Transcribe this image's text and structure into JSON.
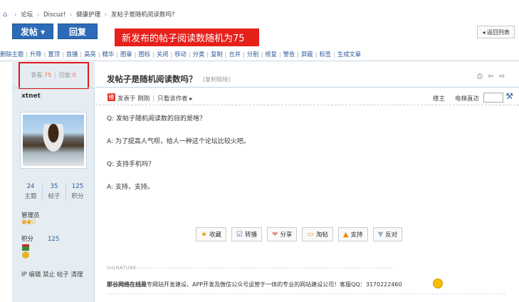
{
  "breadcrumb": {
    "home_icon": "home-icon",
    "items": [
      "论坛",
      "Discuz!",
      "健康护理",
      "发帖子是随机阅读数吗?"
    ]
  },
  "buttons": {
    "post": "发帖 ▾",
    "reply": "回复",
    "back": "◂ 返回列表"
  },
  "banner": "新发布的帖子阅读数随机为75",
  "modbar": [
    "删除主题",
    "升降",
    "置顶",
    "首播",
    "高亮",
    "精华",
    "图章",
    "图标",
    "关闭",
    "移动",
    "分类",
    "复制",
    "合并",
    "分割",
    "修复",
    "警告",
    "屏蔽",
    "标签",
    "生成文章"
  ],
  "thread": {
    "views_label": "查看:",
    "views": "75",
    "replies_label": "回复:",
    "replies": "0",
    "title": "发帖子是随机阅读数吗？",
    "permalink": "[复制链接]",
    "tools": "⎙ ⇦ ⇨"
  },
  "author": {
    "name": "xtnet",
    "stats": [
      {
        "num": "24",
        "label": "主题"
      },
      {
        "num": "35",
        "label": "帖子"
      },
      {
        "num": "125",
        "label": "积分"
      }
    ],
    "role": "管理员",
    "medals": "◉◉✩",
    "points_label": "积分",
    "points": "125",
    "ip_line": "IP 编辑 禁止 帖子 清理"
  },
  "meta": {
    "badge": "楼",
    "posted": "发表于 刚刚",
    "only_author": "只看该作者 ▸",
    "floor_label": "楼主",
    "jump_label": "电梯直达"
  },
  "messages": [
    "Q: 发帖子随机阅读数的目的是啥？",
    "A: 为了提高人气呗，给人一种这个论坛比较火吧。",
    "Q: 支持手机吗？",
    "A: 支持，支持。"
  ],
  "actions": [
    {
      "icon": "★",
      "label": "收藏",
      "color": "#f0a000",
      "name": "favorite"
    },
    {
      "icon": "☑",
      "label": "转播",
      "color": "#3a7bd5",
      "name": "retweet"
    },
    {
      "icon": "❤",
      "label": "分享",
      "color": "#ee8888",
      "name": "share"
    },
    {
      "icon": "▭",
      "label": "淘帖",
      "color": "#e8a317",
      "name": "collect"
    },
    {
      "icon": "▲",
      "label": "支持",
      "color": "#f08a00",
      "name": "support"
    },
    {
      "icon": "▼",
      "label": "反对",
      "color": "#a0b0c0",
      "name": "oppose"
    }
  ],
  "signature": {
    "label": "SIGNATURE",
    "bold": "那谷网络在线是",
    "text": "专网站开发建设、APP开发及微信公众号运营于一体的专业的网站建设公司！客服QQ：3170222460"
  },
  "colors": {
    "accent": "#2d6bb8",
    "banner": "#e6201a",
    "highlight": "#e01818",
    "leftcol": "#e5edf2"
  }
}
